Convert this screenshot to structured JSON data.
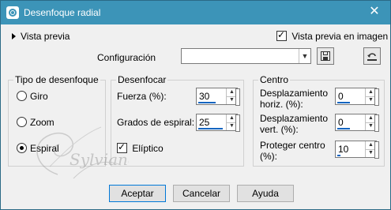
{
  "window": {
    "title": "Desenfoque radial",
    "close_glyph": "✕"
  },
  "preview": {
    "toggle_label": "Vista previa",
    "image_preview_label": "Vista previa en imagen",
    "image_preview_checked": true
  },
  "config": {
    "label": "Configuración",
    "value": ""
  },
  "blur_type": {
    "label": "Tipo de desenfoque",
    "options": [
      {
        "label": "Giro",
        "selected": false
      },
      {
        "label": "Zoom",
        "selected": false
      },
      {
        "label": "Espiral",
        "selected": true
      }
    ]
  },
  "blur": {
    "label": "Desenfocar",
    "strength_label": "Fuerza (%):",
    "strength_value": "30",
    "spiral_label": "Grados de espiral:",
    "spiral_value": "25",
    "elliptic_label": "Elíptico",
    "elliptic_checked": true
  },
  "center": {
    "label": "Centro",
    "hshift_label_1": "Desplazamiento",
    "hshift_label_2": "horiz. (%):",
    "hshift_value": "0",
    "vshift_label_1": "Desplazamiento",
    "vshift_label_2": "vert. (%):",
    "vshift_value": "0",
    "protect_label_1": "Proteger centro",
    "protect_label_2": "(%):",
    "protect_value": "10"
  },
  "buttons": {
    "ok": "Aceptar",
    "cancel": "Cancelar",
    "help": "Ayuda"
  },
  "watermark": {
    "text": "Sylviane"
  },
  "colors": {
    "titlebar": "#3c94b8",
    "accent": "#1565c0",
    "dialog_bg": "#f0f0f0"
  }
}
